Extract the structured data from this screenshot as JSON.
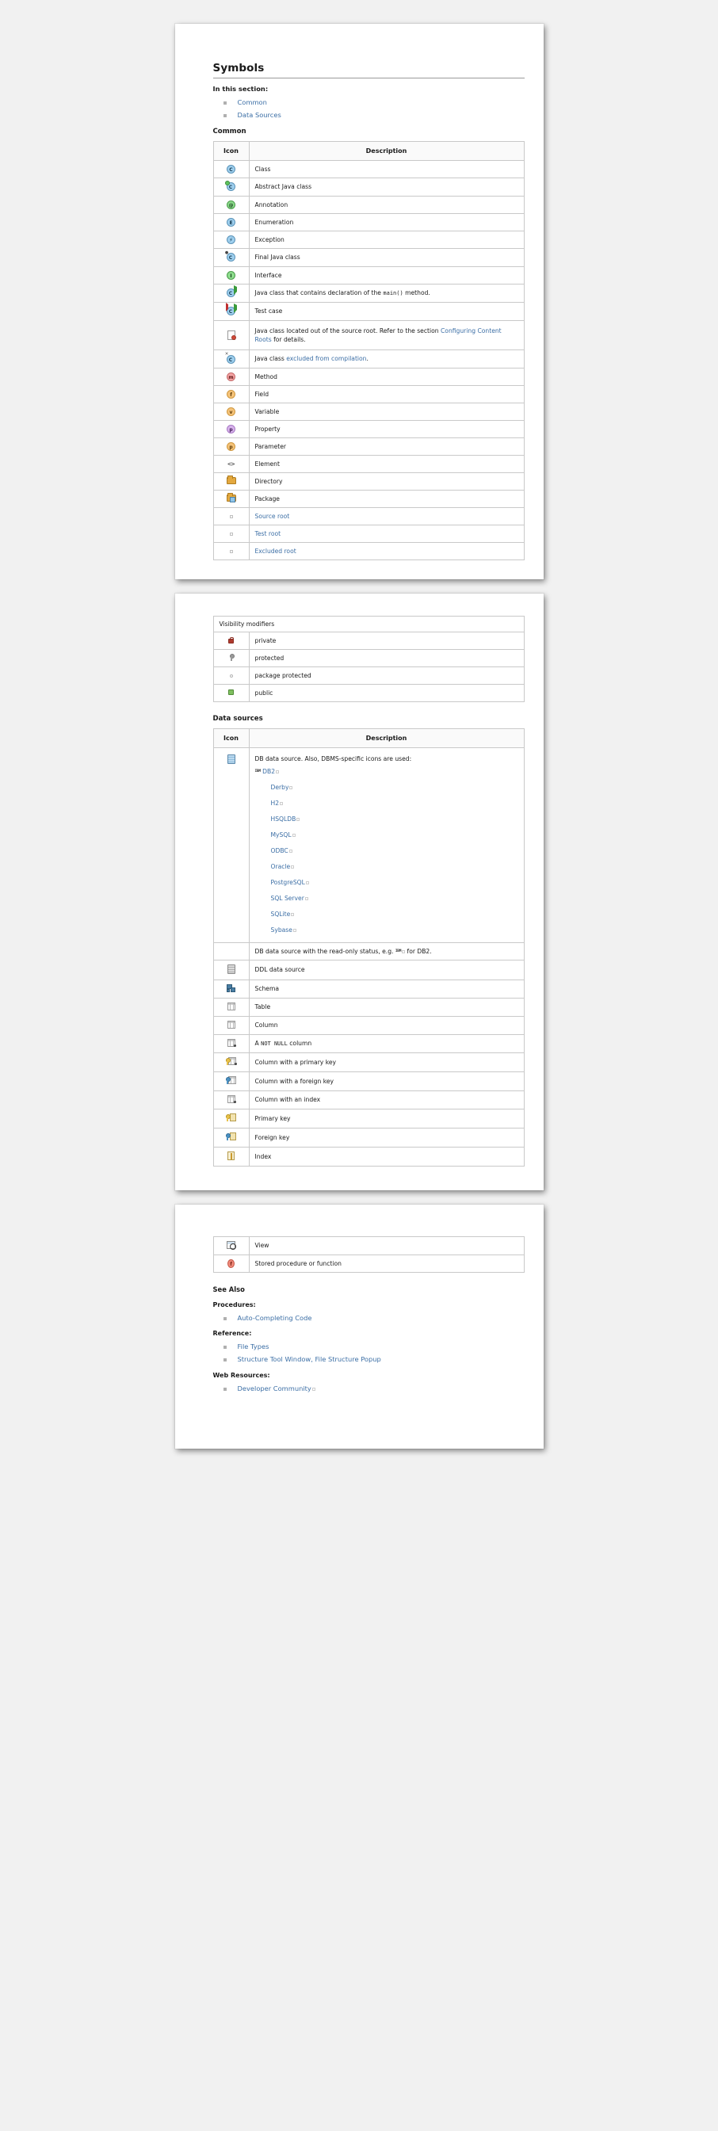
{
  "document": {
    "title": "Symbols",
    "intro_label": "In this section:",
    "toc": [
      {
        "label": "Common"
      },
      {
        "label": "Data Sources"
      }
    ]
  },
  "common_section": {
    "heading": "Common",
    "columns": {
      "icon": "Icon",
      "description": "Description"
    },
    "rows": [
      {
        "icon": "class-icon",
        "text": "Class"
      },
      {
        "icon": "abstract-java-class-icon",
        "text": "Abstract Java class"
      },
      {
        "icon": "annotation-icon",
        "text": "Annotation"
      },
      {
        "icon": "enumeration-icon",
        "text": "Enumeration"
      },
      {
        "icon": "exception-icon",
        "text": "Exception"
      },
      {
        "icon": "final-java-class-icon",
        "text": "Final Java class"
      },
      {
        "icon": "interface-icon",
        "text": "Interface"
      },
      {
        "icon": "main-method-class-icon",
        "text_before": "Java class that contains declaration of the ",
        "code": "main()",
        "text_after": " method."
      },
      {
        "icon": "test-case-icon",
        "text": "Test case"
      },
      {
        "icon": "out-of-source-root-icon",
        "text_before": "Java class located out of the source root. Refer to the section ",
        "link": "Configuring Content Roots",
        "text_after": " for details."
      },
      {
        "icon": "excluded-from-compilation-icon",
        "text_before": "Java class ",
        "link": "excluded from compilation",
        "text_after": "."
      },
      {
        "icon": "method-icon",
        "text": "Method"
      },
      {
        "icon": "field-icon",
        "text": "Field"
      },
      {
        "icon": "variable-icon",
        "text": "Variable"
      },
      {
        "icon": "property-icon",
        "text": "Property"
      },
      {
        "icon": "parameter-icon",
        "text": "Parameter"
      },
      {
        "icon": "element-icon",
        "text": "Element"
      },
      {
        "icon": "directory-icon",
        "text": "Directory"
      },
      {
        "icon": "package-icon",
        "text": "Package"
      },
      {
        "icon": "source-root-icon",
        "link": "Source root"
      },
      {
        "icon": "test-root-icon",
        "link": "Test root"
      },
      {
        "icon": "excluded-root-icon",
        "link": "Excluded root"
      }
    ],
    "visibility_group_label": "Visibility modifiers",
    "visibility_rows": [
      {
        "icon": "private-lock-icon",
        "text": "private"
      },
      {
        "icon": "protected-key-icon",
        "text": "protected"
      },
      {
        "icon": "package-protected-icon",
        "text": "package protected"
      },
      {
        "icon": "public-icon",
        "text": "public"
      }
    ]
  },
  "data_sources_section": {
    "heading": "Data sources",
    "columns": {
      "icon": "Icon",
      "description": "Description"
    },
    "db_row": {
      "icon": "db-data-source-icon",
      "text": "DB data source. Also, DBMS-specific icons are used:",
      "vendors": [
        {
          "label": "DB2",
          "prefix": "IBM"
        },
        {
          "label": "Derby"
        },
        {
          "label": "H2"
        },
        {
          "label": "HSQLDB"
        },
        {
          "label": "MySQL"
        },
        {
          "label": "ODBC"
        },
        {
          "label": "Oracle"
        },
        {
          "label": "PostgreSQL"
        },
        {
          "label": "SQL Server"
        },
        {
          "label": "SQLite"
        },
        {
          "label": "Sybase"
        }
      ]
    },
    "readonly_row": {
      "text_before": "DB data source with the read-only status, e.g. ",
      "badge": "IBM",
      "text_after": " for DB2."
    },
    "rows": [
      {
        "icon": "ddl-data-source-icon",
        "text": "DDL data source"
      },
      {
        "icon": "schema-icon",
        "text": "Schema"
      },
      {
        "icon": "table-icon",
        "text": "Table"
      },
      {
        "icon": "column-icon",
        "text": "Column"
      },
      {
        "icon": "not-null-column-icon",
        "text_before": "A ",
        "code": "NOT NULL",
        "text_after": " column"
      },
      {
        "icon": "column-primary-key-icon",
        "text": "Column with a primary key"
      },
      {
        "icon": "column-foreign-key-icon",
        "text": "Column with a foreign key"
      },
      {
        "icon": "column-index-icon",
        "text": "Column with an index"
      },
      {
        "icon": "primary-key-icon",
        "text": "Primary key"
      },
      {
        "icon": "foreign-key-icon",
        "text": "Foreign key"
      },
      {
        "icon": "index-icon",
        "text": "Index"
      },
      {
        "icon": "view-icon",
        "text": "View"
      },
      {
        "icon": "stored-procedure-icon",
        "text": "Stored procedure or function"
      }
    ]
  },
  "see_also": {
    "heading": "See Also",
    "groups": [
      {
        "label": "Procedures:",
        "links": [
          "Auto-Completing Code"
        ]
      },
      {
        "label": "Reference:",
        "links": [
          "File Types",
          "Structure Tool Window, File Structure Popup"
        ]
      },
      {
        "label": "Web Resources:",
        "links": [
          "Developer Community"
        ]
      }
    ]
  },
  "colors": {
    "link": "#3b6ea5",
    "border": "#c9c9c9",
    "page_bg": "#ffffff",
    "viewer_bg": "#f1f1f1"
  }
}
